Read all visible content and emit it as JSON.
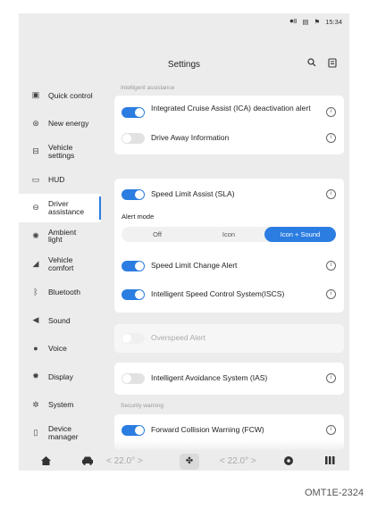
{
  "status_bar": {
    "signal": "⏺8",
    "battery_icon": "▤",
    "bt_icon": "⚑",
    "time": "15:34"
  },
  "header": {
    "title": "Settings",
    "search_icon": "search-icon",
    "doc_icon": "document-icon"
  },
  "sidebar": {
    "items": [
      {
        "label": "Quick control",
        "icon": "quick-control-icon"
      },
      {
        "label": "New energy",
        "icon": "new-energy-icon"
      },
      {
        "label": "Vehicle\nsettings",
        "icon": "car-icon"
      },
      {
        "label": "HUD",
        "icon": "hud-icon"
      },
      {
        "label": "Driver\nassistance",
        "icon": "steering-wheel-icon",
        "active": true
      },
      {
        "label": "Ambient\nlight",
        "icon": "ambient-light-icon"
      },
      {
        "label": "Vehicle\ncomfort",
        "icon": "seat-icon"
      },
      {
        "label": "Bluetooth",
        "icon": "bluetooth-icon"
      },
      {
        "label": "Sound",
        "icon": "speaker-icon"
      },
      {
        "label": "Voice",
        "icon": "microphone-icon"
      },
      {
        "label": "Display",
        "icon": "brightness-icon"
      },
      {
        "label": "System",
        "icon": "gear-icon"
      },
      {
        "label": "Device\nmanager",
        "icon": "device-icon"
      }
    ]
  },
  "content": {
    "section_intelligent": "Intelligent assistance",
    "ica_label": "Integrated Cruise Assist (ICA) deactivation alert",
    "drive_away_label": "Drive Away Information",
    "sla_label": "Speed Limit Assist (SLA)",
    "alert_mode_label": "Alert mode",
    "alert_mode_options": [
      "Off",
      "Icon",
      "Icon + Sound"
    ],
    "alert_mode_selected": "Icon + Sound",
    "speed_change_label": "Speed Limit Change Alert",
    "iscs_label": "Intelligent Speed Control System(ISCS)",
    "overspeed_label": "Overspeed Alert",
    "ias_label": "Intelligent Avoidance System (IAS)",
    "section_security": "Security warning",
    "fcw_label": "Forward Collision Warning (FCW)",
    "info_glyph": "i"
  },
  "bottom_bar": {
    "left_temp": "< 22.0° >",
    "right_temp": "< 22.0° >"
  },
  "caption": "OMT1E-2324",
  "colors": {
    "accent": "#2b7de1",
    "background": "#ececec",
    "card": "#ffffff"
  }
}
